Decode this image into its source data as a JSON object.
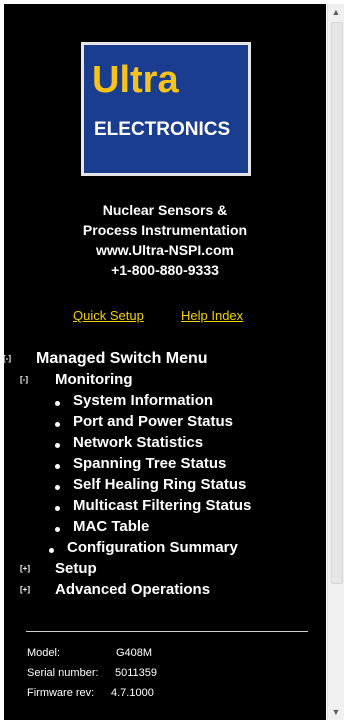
{
  "logo": {
    "top_text": "Ultra",
    "bottom_text": "ELECTRONICS",
    "colors": {
      "background": "#1b3d8f",
      "top_text": "#f6c21c",
      "bottom_text": "#ffffff"
    }
  },
  "company": {
    "line1": "Nuclear Sensors &",
    "line2": "Process Instrumentation",
    "website": "www.Ultra-NSPI.com",
    "phone": "+1-800-880-9333"
  },
  "links": {
    "quick_setup": "Quick Setup",
    "help_index": "Help Index",
    "color": "#f4d000"
  },
  "menu": {
    "root": {
      "toggle": "[-]",
      "label": "Managed Switch Menu"
    },
    "monitoring": {
      "toggle": "[-]",
      "label": "Monitoring"
    },
    "monitoring_items": [
      "System Information",
      "Port and Power Status",
      "Network Statistics",
      "Spanning Tree Status",
      "Self Healing Ring Status",
      "Multicast Filtering Status",
      "MAC Table",
      "Configuration Summary"
    ],
    "setup": {
      "toggle": "[+]",
      "label": "Setup"
    },
    "advanced": {
      "toggle": "[+]",
      "label": "Advanced Operations"
    }
  },
  "device_info": {
    "model_label": "Model:",
    "model_value": "G408M",
    "serial_label": "Serial number:",
    "serial_value": "5011359",
    "firmware_label": "Firmware rev:",
    "firmware_value": "4.7.1000"
  },
  "scrollbar": {
    "up_icon": "triangle-up",
    "down_icon": "triangle-down"
  }
}
